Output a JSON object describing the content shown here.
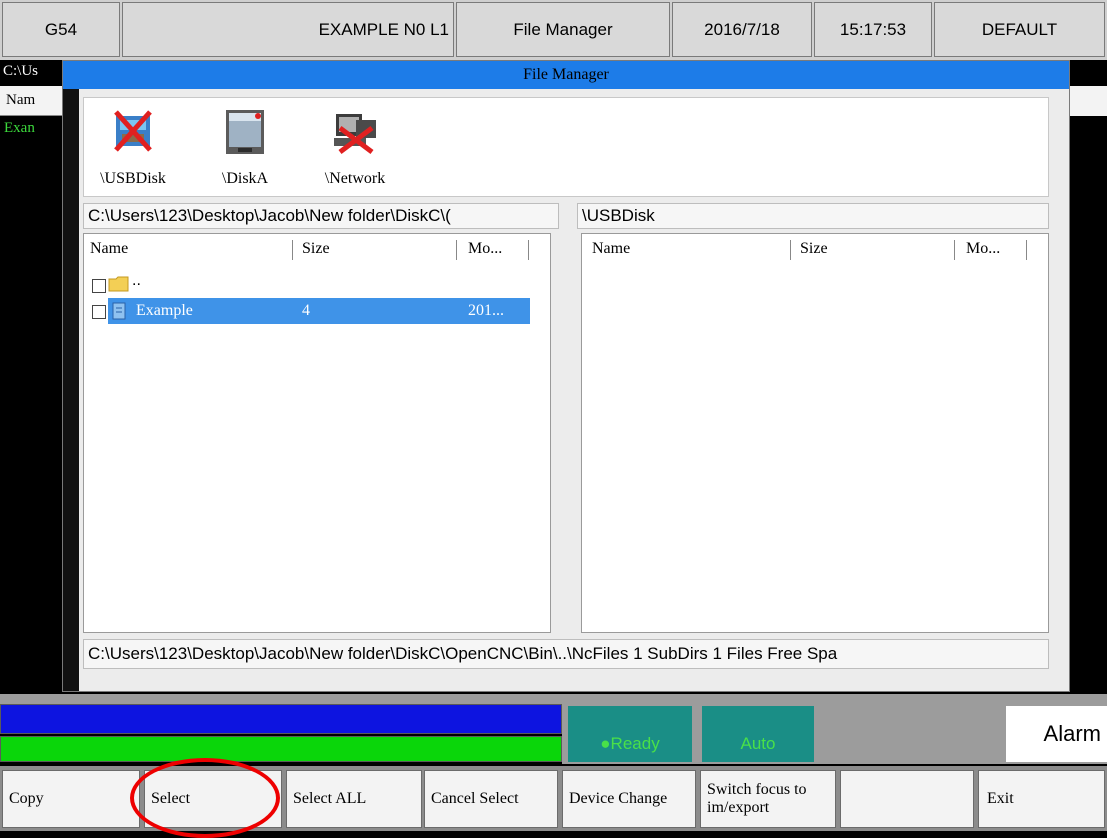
{
  "top_bar": {
    "coord_system": "G54",
    "program": "EXAMPLE N0 L1",
    "title": "File Manager",
    "date": "2016/7/18",
    "time": "15:17:53",
    "mode": "DEFAULT"
  },
  "background": {
    "path": "C:\\Us",
    "name_col": "Nam",
    "row": "Exan"
  },
  "dialog": {
    "title": "File Manager",
    "devices": [
      {
        "label": "\\USBDisk",
        "icon": "usb-disk-disconnected-icon"
      },
      {
        "label": "\\DiskA",
        "icon": "disk-a-icon"
      },
      {
        "label": "\\Network",
        "icon": "network-disconnected-icon"
      }
    ],
    "left_path": "C:\\Users\\123\\Desktop\\Jacob\\New folder\\DiskC\\(",
    "right_path": "\\USBDisk",
    "columns": {
      "name": "Name",
      "size": "Size",
      "modified": "Mo..."
    },
    "left_rows": [
      {
        "name": "..",
        "size": "",
        "modified": "",
        "type": "folder",
        "selected": false
      },
      {
        "name": "Example",
        "size": "4",
        "modified": "201...",
        "type": "file",
        "selected": true
      }
    ],
    "status_line": "C:\\Users\\123\\Desktop\\Jacob\\New folder\\DiskC\\OpenCNC\\Bin\\..\\NcFiles 1 SubDirs 1 Files Free Spa"
  },
  "status": {
    "ready": "●Ready",
    "auto": "Auto",
    "alarm": "Alarm"
  },
  "softkeys": [
    {
      "id": "copy",
      "label": "Copy"
    },
    {
      "id": "select",
      "label": "Select"
    },
    {
      "id": "select-all",
      "label": "Select ALL"
    },
    {
      "id": "cancel-select",
      "label": "Cancel Select"
    },
    {
      "id": "device-change",
      "label": "Device Change"
    },
    {
      "id": "switch-focus",
      "label": "Switch focus to im/export"
    },
    {
      "id": "empty",
      "label": ""
    },
    {
      "id": "exit",
      "label": "Exit"
    }
  ],
  "colors": {
    "title_blue": "#1d7ce8",
    "selection_blue": "#3f93e8",
    "status_teal": "#1a8e86",
    "status_green_text": "#49e049",
    "highlight_red": "#e00000"
  }
}
